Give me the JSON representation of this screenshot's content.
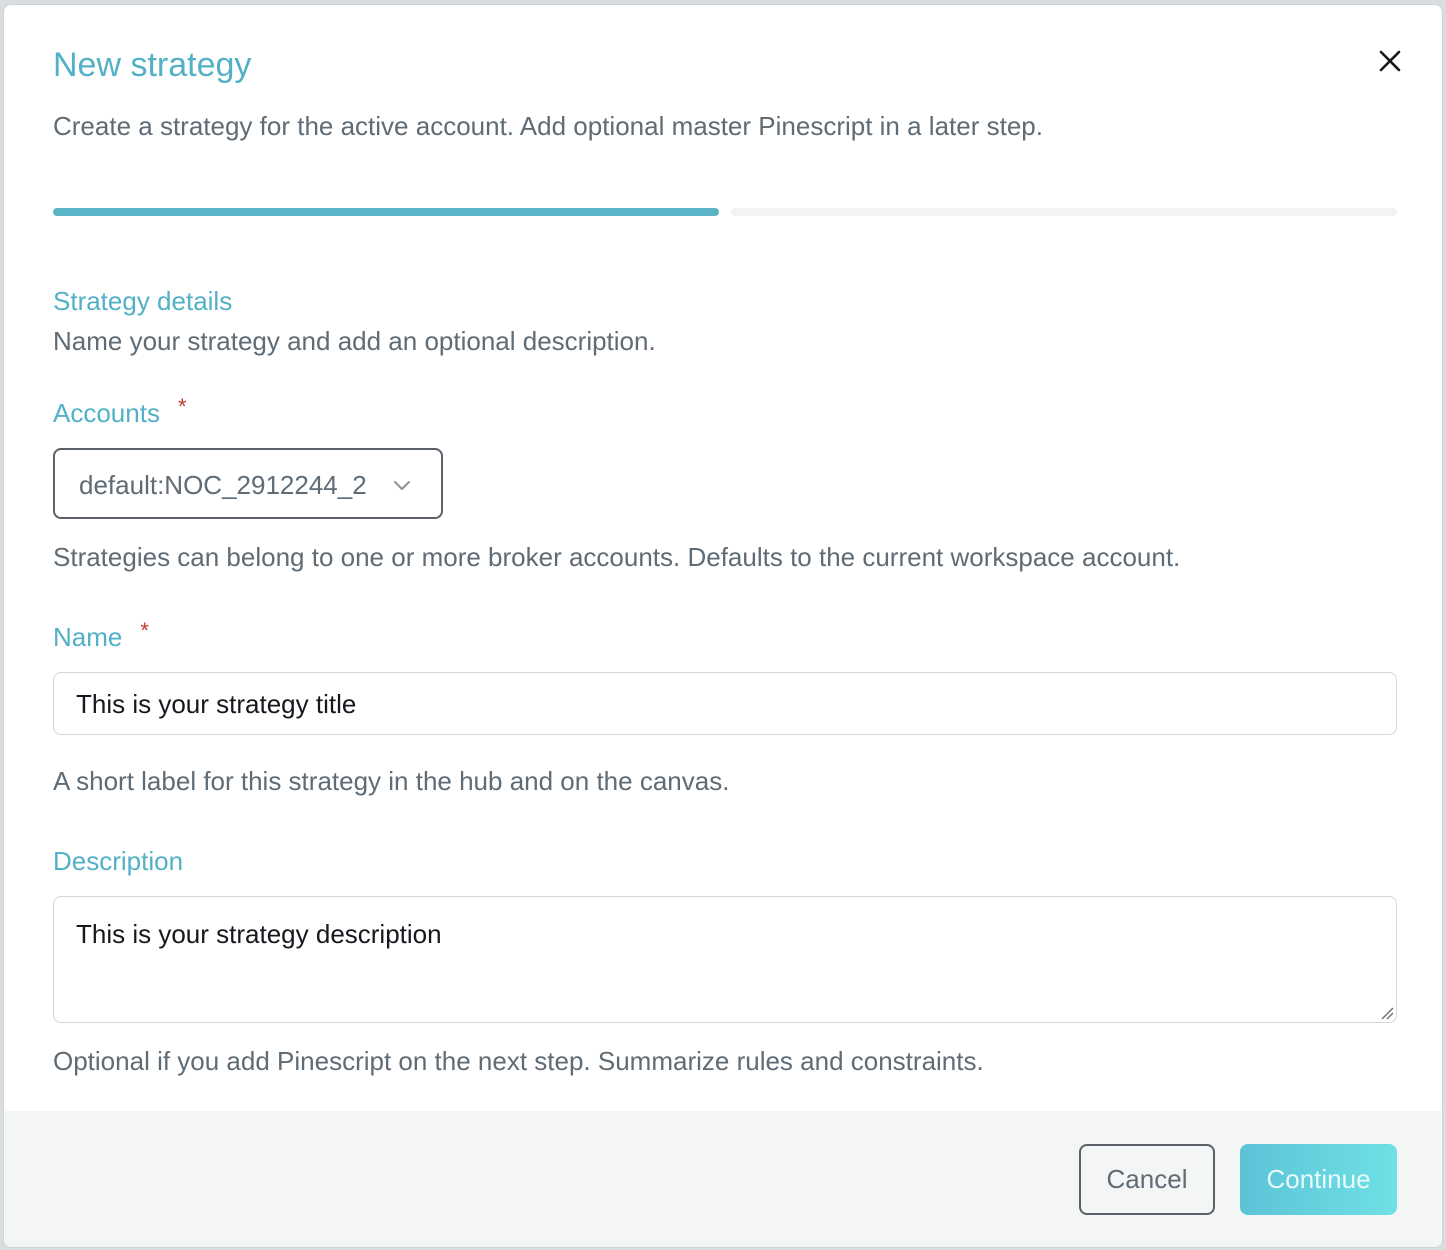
{
  "dialog": {
    "title": "New strategy",
    "subtitle": "Create a strategy for the active account. Add optional master Pinescript in a later step.",
    "close_icon": "close-icon"
  },
  "progress": {
    "current_step": 1,
    "total_steps": 2
  },
  "section": {
    "title": "Strategy details",
    "description": "Name your strategy and add an optional description."
  },
  "fields": {
    "accounts": {
      "label": "Accounts",
      "required_mark": "*",
      "selected": "default:NOC_2912244_2",
      "help": "Strategies can belong to one or more broker accounts. Defaults to the current workspace account."
    },
    "name": {
      "label": "Name",
      "required_mark": "*",
      "value": "This is your strategy title",
      "help": "A short label for this strategy in the hub and on the canvas."
    },
    "description": {
      "label": "Description",
      "value": "This is your strategy description",
      "help": "Optional if you add Pinescript on the next step. Summarize rules and constraints."
    }
  },
  "footer": {
    "cancel_label": "Cancel",
    "continue_label": "Continue"
  },
  "colors": {
    "accent": "#52b1c6",
    "progress_active": "#5ab4c8",
    "required": "#c33a2c",
    "continue_gradient_start": "#5cc3d6",
    "continue_gradient_end": "#6fe1e6"
  }
}
